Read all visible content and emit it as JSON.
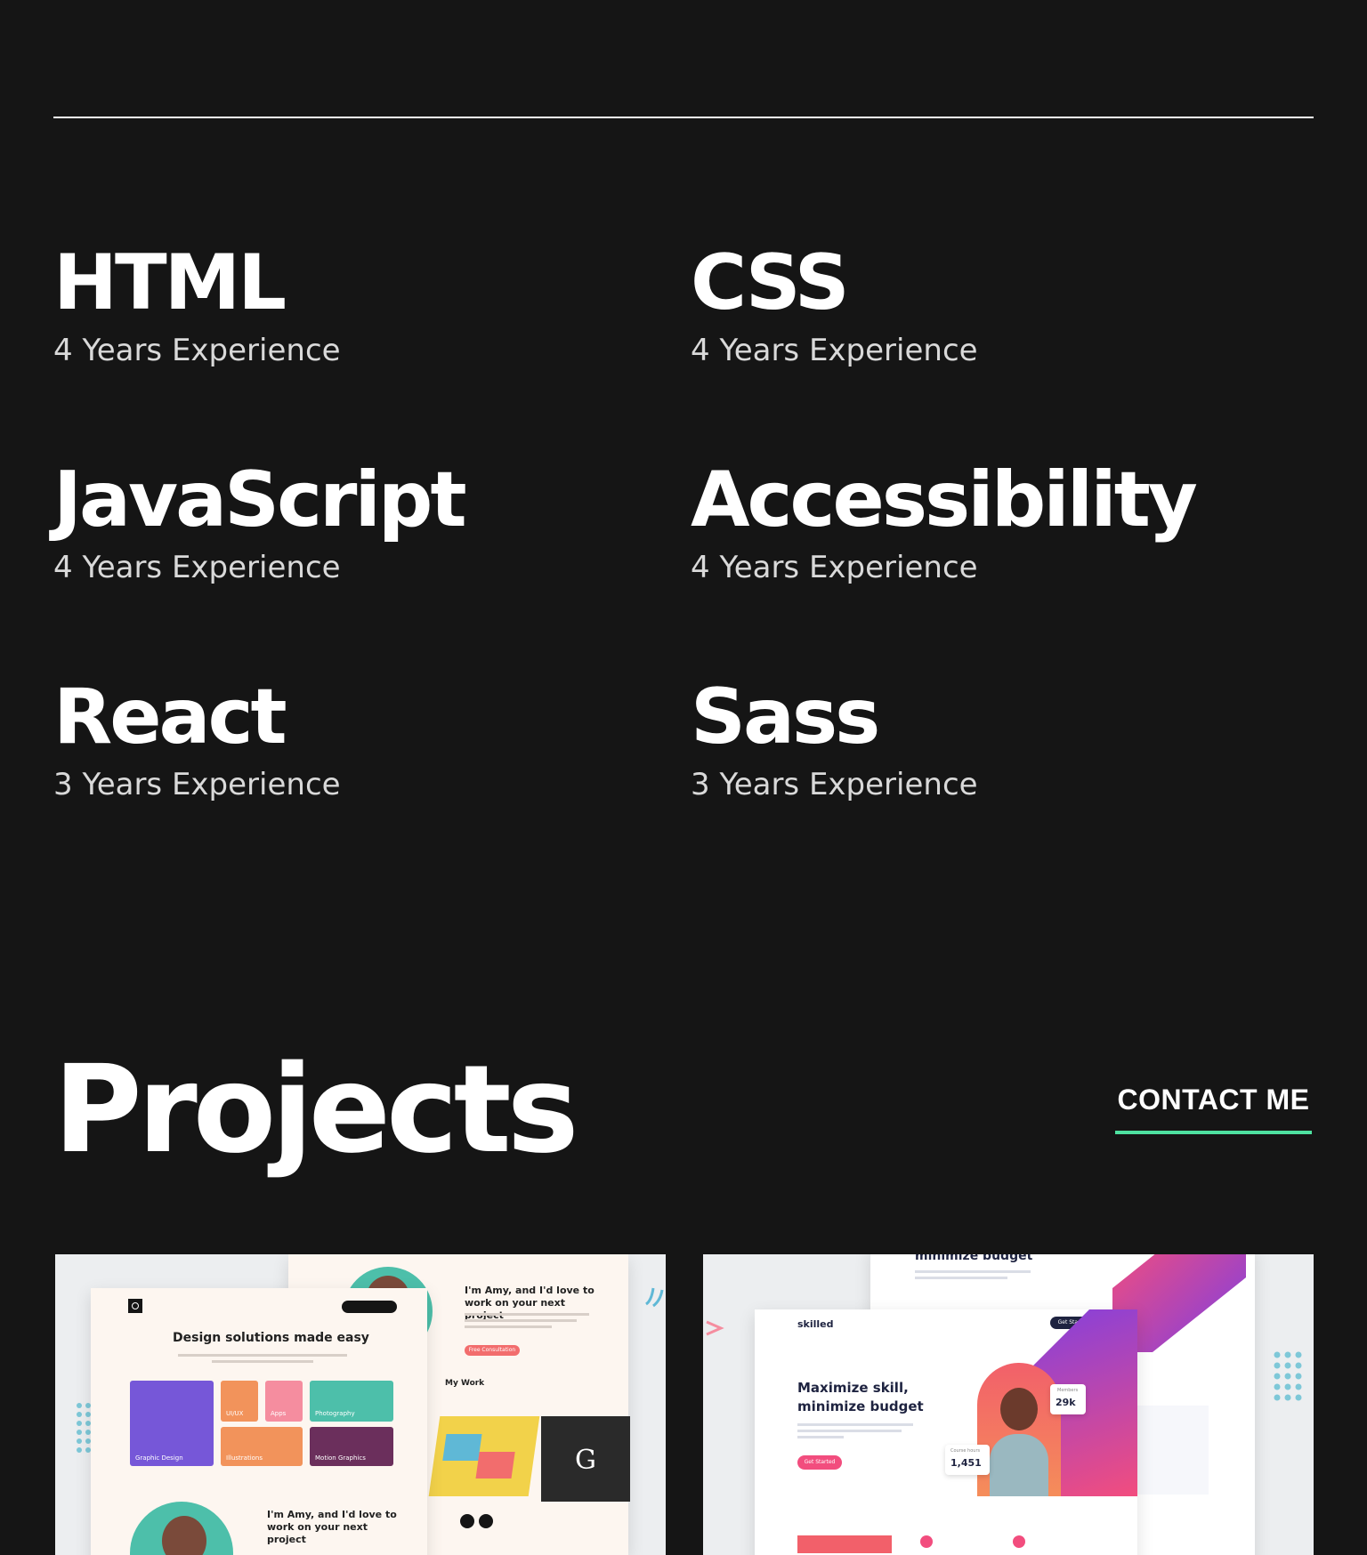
{
  "skills": [
    {
      "name": "HTML",
      "experience": "4 Years Experience"
    },
    {
      "name": "CSS",
      "experience": "4 Years Experience"
    },
    {
      "name": "JavaScript",
      "experience": "4 Years Experience"
    },
    {
      "name": "Accessibility",
      "experience": "4 Years Experience"
    },
    {
      "name": "React",
      "experience": "3 Years Experience"
    },
    {
      "name": "Sass",
      "experience": "3 Years Experience"
    }
  ],
  "projects": {
    "title": "Projects",
    "contact_label": "CONTACT ME",
    "accent_color": "#4ee1a0"
  },
  "project_cards": [
    {
      "headline": "Design solutions made easy",
      "intro": "I'm Amy, and I'd love to work on your next project",
      "cta": "Free Consultation",
      "section": "My Work",
      "tiles": [
        "Graphic Design",
        "UI/UX",
        "Apps",
        "Photography",
        "Illustrations",
        "Motion Graphics"
      ]
    },
    {
      "brand": "skilled",
      "cta": "Get Started",
      "headline": "Maximize skill, minimize budget",
      "top_text": "minimize budget",
      "stat_members_label": "Members",
      "stat_members": "29k",
      "stat_hours_label": "Course hours",
      "stat_hours": "1,451"
    }
  ]
}
